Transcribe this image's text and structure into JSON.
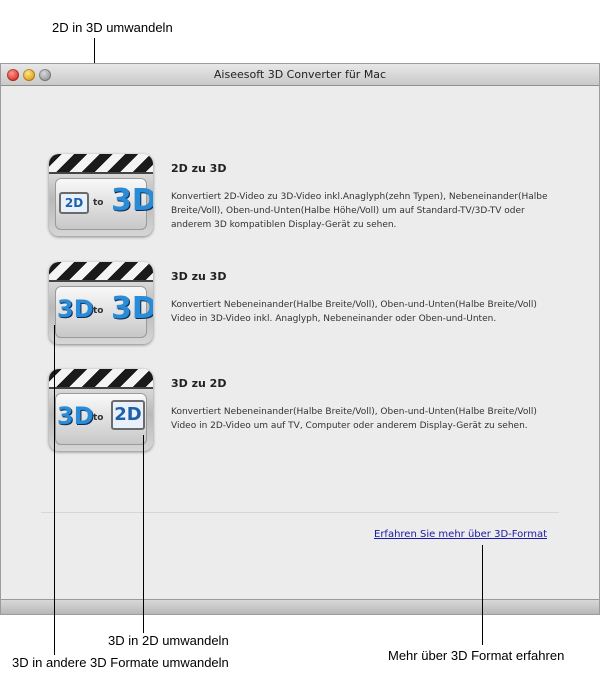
{
  "callouts": {
    "top": "2D in 3D umwandeln",
    "bottom_middle": "3D in 2D umwandeln",
    "bottom_left": "3D in andere 3D Formate umwandeln",
    "bottom_right": "Mehr über 3D Format erfahren"
  },
  "window": {
    "title": "Aiseesoft 3D Converter für Mac"
  },
  "items": [
    {
      "title": "2D zu 3D",
      "description": "Konvertiert 2D-Video zu 3D-Video inkl.Anaglyph(zehn Typen), Nebeneinander(Halbe Breite/Voll), Oben-und-Unten(Halbe Höhe/Voll) um auf Standard-TV/3D-TV oder anderem 3D kompatiblen Display-Gerät zu sehen.",
      "icon_left": "2D",
      "icon_mid": "to",
      "icon_right": "3D"
    },
    {
      "title": "3D zu 3D",
      "description": "Konvertiert Nebeneinander(Halbe Breite/Voll), Oben-und-Unten(Halbe Breite/Voll) Video in 3D-Video inkl. Anaglyph, Nebeneinander oder Oben-und-Unten.",
      "icon_left": "3D",
      "icon_mid": "to",
      "icon_right": "3D"
    },
    {
      "title": "3D zu 2D",
      "description": "Konvertiert Nebeneinander(Halbe Breite/Voll), Oben-und-Unten(Halbe Breite/Voll) Video in 2D-Video um auf TV, Computer oder anderem Display-Gerät zu sehen.",
      "icon_left": "3D",
      "icon_mid": "to",
      "icon_right": "2D"
    }
  ],
  "footer": {
    "learn_more": "Erfahren Sie mehr über 3D-Format"
  },
  "colors": {
    "link": "#1a1aa6",
    "accent_3d": "#2a8bd6"
  }
}
